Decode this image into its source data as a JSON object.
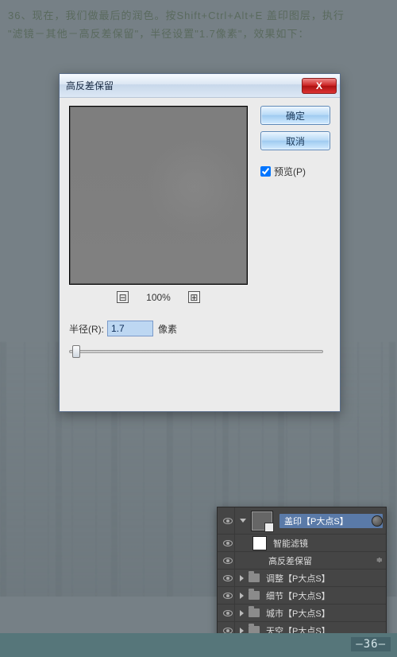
{
  "instruction": {
    "line1": "36、现在，我们做最后的润色。按Shift+Ctrl+Alt+E 盖印图层，执行",
    "line2": "\"滤镜－其他－高反差保留\"，半径设置\"1.7像素\"，效果如下："
  },
  "dialog": {
    "title": "高反差保留",
    "close_x": "X",
    "zoom_minus": "⊟",
    "zoom_plus": "⊞",
    "zoom_value": "100%",
    "radius_label": "半径(R):",
    "radius_value": "1.7",
    "radius_unit": "像素",
    "ok_label": "确定",
    "cancel_label": "取消",
    "preview_label": "预览(P)"
  },
  "layers": {
    "row1": "盖印【P大点S】",
    "row2": "智能滤镜",
    "row3": "高反差保留",
    "row4": "调整【P大点S】",
    "row5": "细节【P大点S】",
    "row6": "城市【P大点S】",
    "row7": "天空【P大点S】",
    "fx": "≑"
  },
  "footer": {
    "step": "—36—"
  }
}
